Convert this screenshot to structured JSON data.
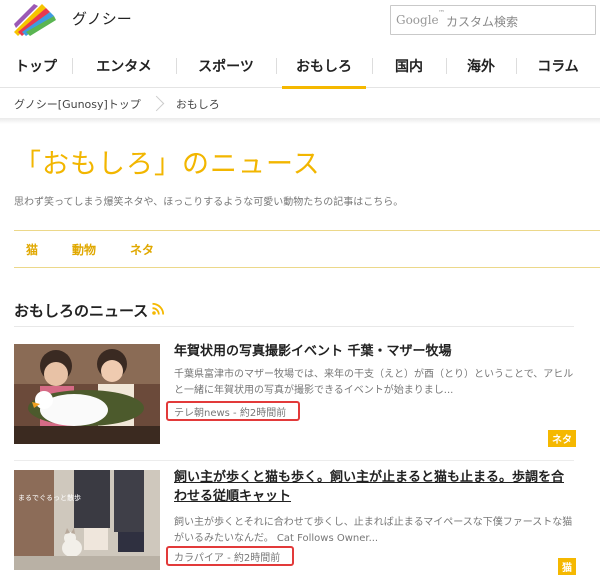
{
  "header": {
    "site_name": "グノシー",
    "logo_colors": [
      "#f6c400",
      "#e8384f",
      "#3f9be0",
      "#5ab552",
      "#9b59b6"
    ]
  },
  "search": {
    "brand": "Google",
    "placeholder": "カスタム検索",
    "tm": "™"
  },
  "nav": {
    "items": [
      {
        "label": "トップ",
        "active": false
      },
      {
        "label": "エンタメ",
        "active": false
      },
      {
        "label": "スポーツ",
        "active": false
      },
      {
        "label": "おもしろ",
        "active": true
      },
      {
        "label": "国内",
        "active": false
      },
      {
        "label": "海外",
        "active": false
      },
      {
        "label": "コラム",
        "active": false
      }
    ],
    "accent_color": "#f5b800"
  },
  "breadcrumb": {
    "items": [
      "グノシー[Gunosy]トップ",
      "おもしろ"
    ]
  },
  "page": {
    "title": "「おもしろ」のニュース",
    "description": "思わず笑ってしまう爆笑ネタや、ほっこりするような可愛い動物たちの記事はこちら。",
    "tags": [
      "猫",
      "動物",
      "ネタ"
    ]
  },
  "section": {
    "title": "おもしろのニュース",
    "icon": "rss-icon"
  },
  "articles": [
    {
      "title": "年賀状用の写真撮影イベント 千葉・マザー牧場",
      "excerpt": "千葉県富津市のマザー牧場では、来年の干支（えと）が酉（とり）ということで、アヒルと一緒に年賀状用の写真が撮影できるイベントが始まりまし...",
      "source": "テレ朝news - 約2時間前",
      "badge": "ネタ"
    },
    {
      "title": "飼い主が歩くと猫も歩く。飼い主が止まると猫も止まる。歩調を合わせる従順キャット",
      "excerpt": "飼い主が歩くとそれに合わせて歩くし、止まれば止まるマイペースな下僕ファーストな猫がいるみたいなんだ。 Cat Follows Owner...",
      "source": "カラパイア - 約2時間前",
      "badge": "猫",
      "thumb_caption": "まるでぐるっと散歩"
    }
  ]
}
